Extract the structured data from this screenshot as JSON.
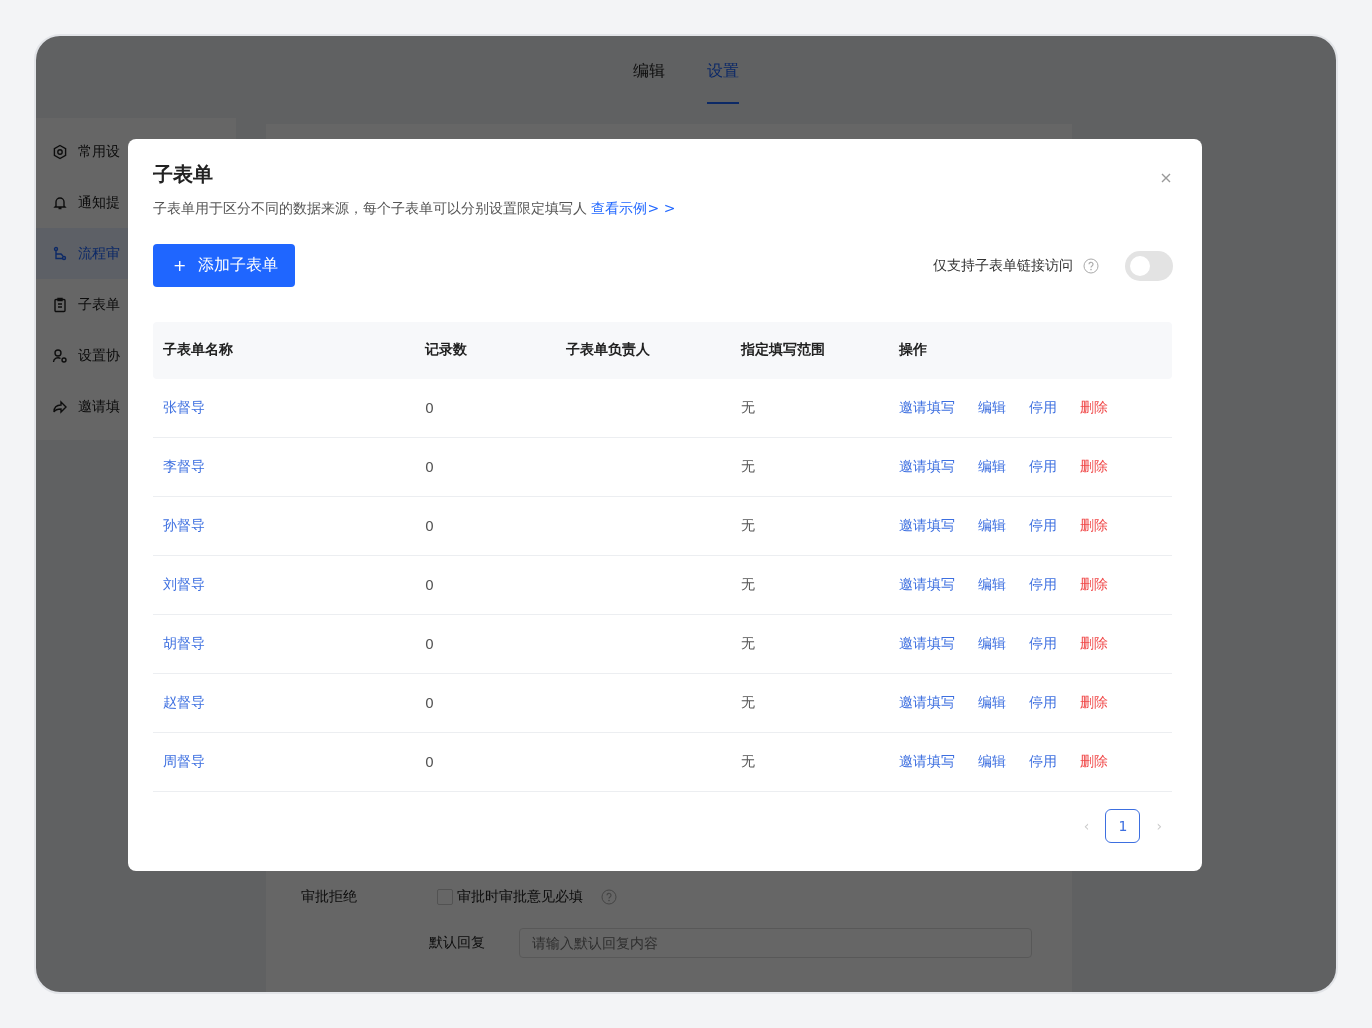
{
  "app_tabs": [
    {
      "label": "编辑",
      "selected": false
    },
    {
      "label": "设置",
      "selected": true
    }
  ],
  "sidebar": {
    "items": [
      {
        "label": "常用设",
        "selected": false
      },
      {
        "label": "通知提",
        "selected": false
      },
      {
        "label": "流程审",
        "selected": true
      },
      {
        "label": "子表单",
        "selected": false
      },
      {
        "label": "设置协",
        "selected": false
      },
      {
        "label": "邀请填",
        "selected": false
      }
    ]
  },
  "background_form": {
    "reject_label": "审批拒绝",
    "required_checkbox": {
      "label": "审批时审批意见必填",
      "checked": false
    },
    "reply_label": "默认回复",
    "reply_field": {
      "placeholder": "请输入默认回复内容"
    }
  },
  "dialog": {
    "title": "子表单",
    "description": "子表单用于区分不同的数据来源，每个子表单可以分别设置限定填写人",
    "example_link": "查看示例> >",
    "add_button": "添加子表单",
    "add_icon": "+",
    "link_only_toggle": {
      "label": "仅支持子表单链接访问",
      "on": false
    },
    "table": {
      "columns": [
        "子表单名称",
        "记录数",
        "子表单负责人",
        "指定填写范围",
        "操作"
      ],
      "rows": [
        {
          "name": "张督导",
          "records": "0",
          "range": "无",
          "actions": [
            {
              "label": "邀请填写",
              "kind": "link"
            },
            {
              "label": "编辑",
              "kind": "link"
            },
            {
              "label": "停用",
              "kind": "link"
            },
            {
              "label": "删除",
              "kind": "danger"
            }
          ]
        },
        {
          "name": "李督导",
          "records": "0",
          "range": "无",
          "actions": [
            {
              "label": "邀请填写",
              "kind": "link"
            },
            {
              "label": "编辑",
              "kind": "link"
            },
            {
              "label": "停用",
              "kind": "link"
            },
            {
              "label": "删除",
              "kind": "danger"
            }
          ]
        },
        {
          "name": "孙督导",
          "records": "0",
          "range": "无",
          "actions": [
            {
              "label": "邀请填写",
              "kind": "link"
            },
            {
              "label": "编辑",
              "kind": "link"
            },
            {
              "label": "停用",
              "kind": "link"
            },
            {
              "label": "删除",
              "kind": "danger"
            }
          ]
        },
        {
          "name": "刘督导",
          "records": "0",
          "range": "无",
          "actions": [
            {
              "label": "邀请填写",
              "kind": "link"
            },
            {
              "label": "编辑",
              "kind": "link"
            },
            {
              "label": "停用",
              "kind": "link"
            },
            {
              "label": "删除",
              "kind": "danger"
            }
          ]
        },
        {
          "name": "胡督导",
          "records": "0",
          "range": "无",
          "actions": [
            {
              "label": "邀请填写",
              "kind": "link"
            },
            {
              "label": "编辑",
              "kind": "link"
            },
            {
              "label": "停用",
              "kind": "link"
            },
            {
              "label": "删除",
              "kind": "danger"
            }
          ]
        },
        {
          "name": "赵督导",
          "records": "0",
          "range": "无",
          "actions": [
            {
              "label": "邀请填写",
              "kind": "link"
            },
            {
              "label": "编辑",
              "kind": "link"
            },
            {
              "label": "停用",
              "kind": "link"
            },
            {
              "label": "删除",
              "kind": "danger"
            }
          ]
        },
        {
          "name": "周督导",
          "records": "0",
          "range": "无",
          "actions": [
            {
              "label": "邀请填写",
              "kind": "link"
            },
            {
              "label": "编辑",
              "kind": "link"
            },
            {
              "label": "停用",
              "kind": "link"
            },
            {
              "label": "删除",
              "kind": "danger"
            }
          ]
        }
      ]
    },
    "pagination": {
      "prev": "‹",
      "next": "›",
      "pages": [
        {
          "label": "1",
          "selected": true
        }
      ]
    }
  }
}
